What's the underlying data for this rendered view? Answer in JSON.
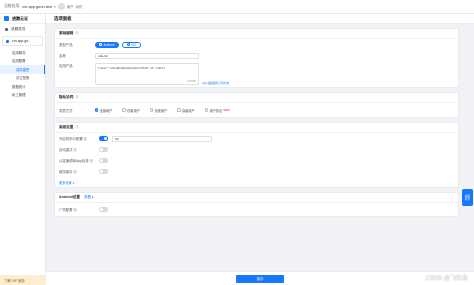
{
  "topbar": {
    "label": "当前应用:",
    "app": "cm-app-geoh-test",
    "caret": "▾",
    "user": "用户",
    "edit": "编辑"
  },
  "sidebar": {
    "brand": "透腾云证",
    "overview": "总概览况",
    "app": "cm-app-ge...",
    "items": [
      "应用概况",
      "应用配置"
    ],
    "subitems": [
      "选择建签",
      "设立配置"
    ],
    "data": "数据统计",
    "privacy": "私工管理",
    "vip": "了解 VIP 服务"
  },
  "page": {
    "title": "选项面板"
  },
  "basic": {
    "title": "基础编辑",
    "q": "⓪",
    "type_label": "类型产品",
    "type_btn1": "Android",
    "type_btn2": "iOS",
    "name_label": "名称",
    "name_value": "mfa-02",
    "desc_label": "应用产品",
    "desc_value": "{\"desc\":\"\\u9ed8\\u8ba4\\u5e94\\u7528\",\"id\":\"1001\"}",
    "desc_tip": "0/4096",
    "help": "App 描述默认可补充"
  },
  "channel": {
    "title": "隐私协同",
    "q": "⓪",
    "label": "同意方式",
    "options": [
      "全部用户",
      "仅新用户",
      "仅老用户",
      "高级用户",
      "用户协议"
    ],
    "new_tag": "NEW"
  },
  "advanced": {
    "title": "高级设置",
    "q": "⓪",
    "rows": [
      {
        "label": "开启同步ID配置 ⓪",
        "value": "60",
        "on": true
      },
      {
        "label": "自动重试 ⓪",
        "on": false
      },
      {
        "label": "以高速调用App检查 ⓪",
        "on": false
      },
      {
        "label": "维持保存 ⓪",
        "on": false
      }
    ],
    "more": "更多设置 ▾"
  },
  "android": {
    "title": "Android设置",
    "link": "查看 ▸",
    "row_label": "厂商配置 ⓪"
  },
  "footer": {
    "save": "保存"
  },
  "float": {
    "line1": "客服",
    "line2": "助手"
  },
  "watermark": "CSDN @飞吃鱼",
  "colors": {
    "accent": "#1677ff",
    "bg": "#f0f2f5"
  }
}
